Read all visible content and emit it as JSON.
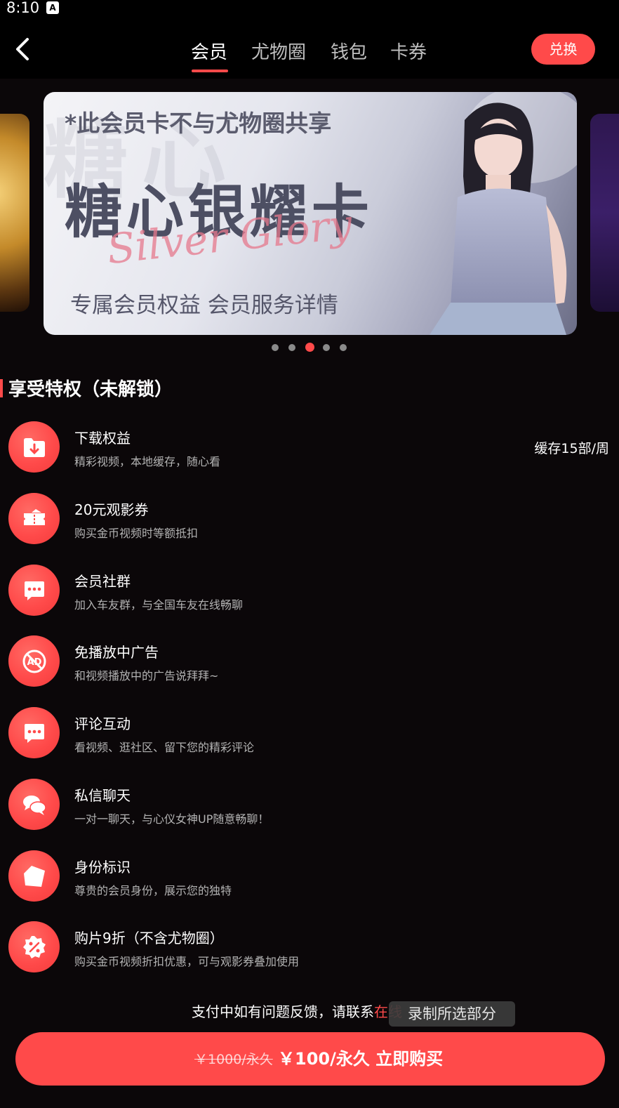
{
  "status_bar": {
    "time": "8:10",
    "badge": "A"
  },
  "nav": {
    "tabs": [
      {
        "label": "会员",
        "active": true
      },
      {
        "label": "尤物圈",
        "active": false
      },
      {
        "label": "钱包",
        "active": false
      },
      {
        "label": "卡券",
        "active": false
      }
    ],
    "exchange_label": "兑换"
  },
  "banner": {
    "note": "*此会员卡不与尤物圈共享",
    "title": "糖心银耀卡",
    "script": "Silver Glory",
    "links": "专属会员权益  会员服务详情",
    "slide_count": 5,
    "active_slide": 3
  },
  "section": {
    "title": "享受特权（未解锁）"
  },
  "privileges": [
    {
      "icon": "download-folder-icon",
      "title": "下载权益",
      "desc": "精彩视频，本地缓存，随心看",
      "value": "缓存15部/周"
    },
    {
      "icon": "ticket-icon",
      "title": "20元观影券",
      "desc": "购买金币视频时等额抵扣",
      "value": ""
    },
    {
      "icon": "chat-bubble-icon",
      "title": "会员社群",
      "desc": "加入车友群，与全国车友在线畅聊",
      "value": ""
    },
    {
      "icon": "ad-block-icon",
      "title": "免播放中广告",
      "desc": "和视频播放中的广告说拜拜~",
      "value": ""
    },
    {
      "icon": "comment-icon",
      "title": "评论互动",
      "desc": "看视频、逛社区、留下您的精彩评论",
      "value": ""
    },
    {
      "icon": "private-message-icon",
      "title": "私信聊天",
      "desc": "一对一聊天，与心仪女神UP随意畅聊！",
      "value": ""
    },
    {
      "icon": "identity-tag-icon",
      "title": "身份标识",
      "desc": "尊贵的会员身份，展示您的独特",
      "value": ""
    },
    {
      "icon": "discount-badge-icon",
      "title": "购片9折（不含尤物圈）",
      "desc": "购买金币视频折扣优惠，可与观影券叠加使用",
      "value": ""
    }
  ],
  "contact": {
    "prefix": "支付中如有问题反馈，请联系",
    "link": "在线"
  },
  "toast": "录制所选部分",
  "purchase": {
    "old_price": "￥1000/永久",
    "new_price": "￥100/永久 立即购买"
  },
  "colors": {
    "accent": "#ff4a4a",
    "background": "#0b0709"
  }
}
